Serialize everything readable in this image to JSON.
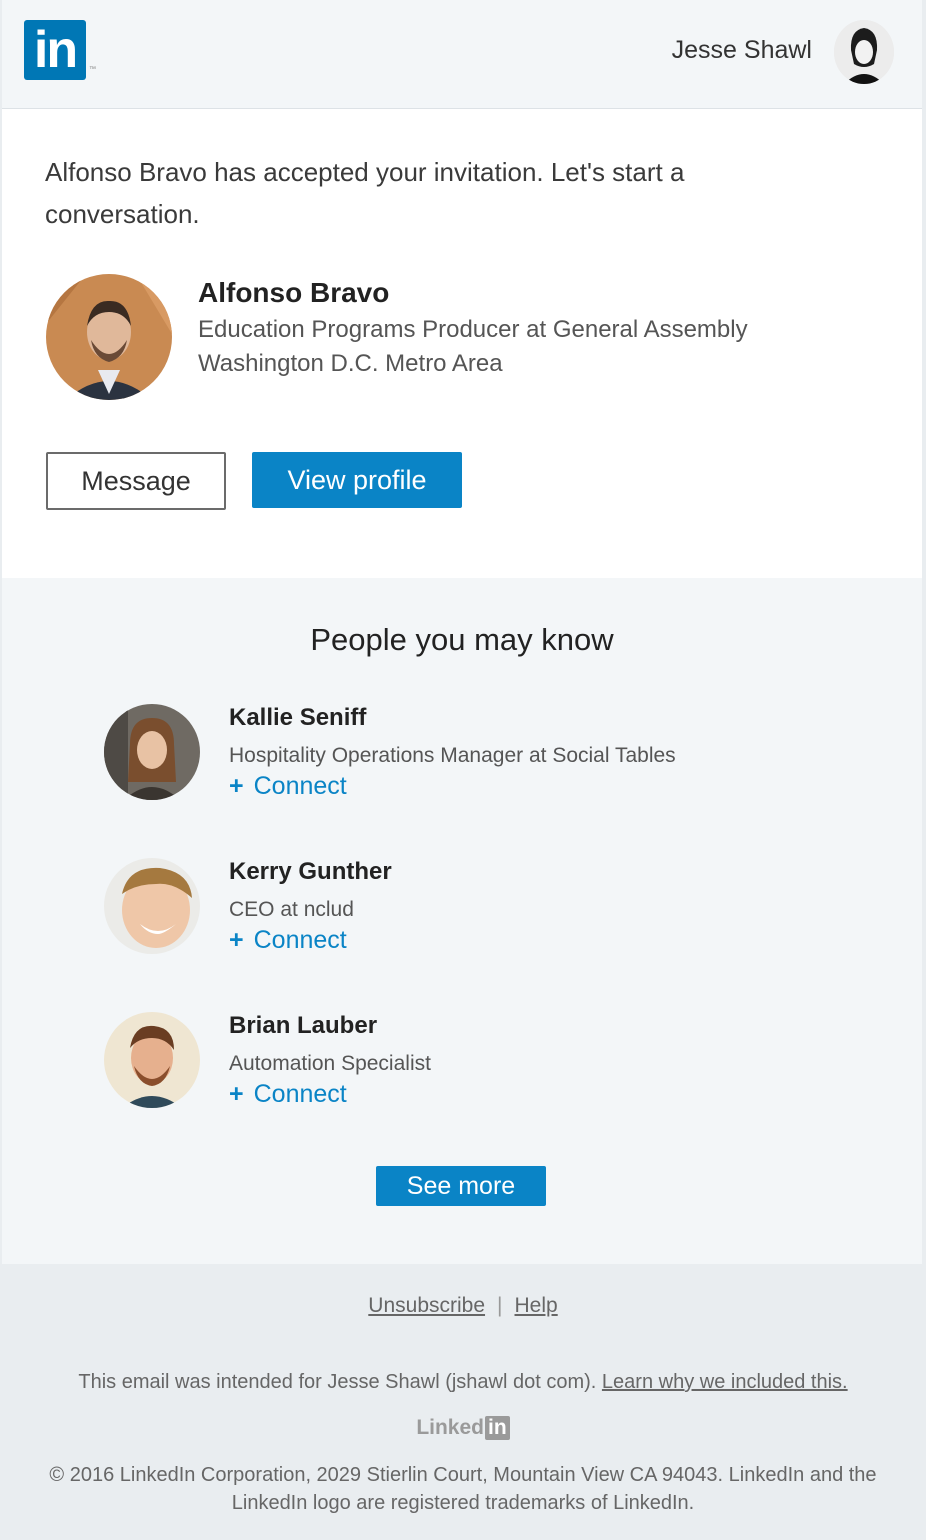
{
  "header": {
    "logo_text": "in",
    "logo_tm": "™",
    "user_name": "Jesse Shawl",
    "avatar_icon": "user-avatar-photo"
  },
  "main": {
    "intro": "Alfonso Bravo has accepted your invitation. Let's start a conversation.",
    "person": {
      "name": "Alfonso Bravo",
      "title": "Education Programs Producer at General Assembly",
      "location": "Washington D.C. Metro Area"
    },
    "buttons": {
      "message": "Message",
      "view_profile": "View profile"
    }
  },
  "pymk": {
    "title": "People you may know",
    "connect_icon": "+",
    "people": [
      {
        "name": "Kallie Seniff",
        "headline": "Hospitality Operations Manager at Social Tables",
        "connect": "Connect"
      },
      {
        "name": "Kerry Gunther",
        "headline": "CEO at nclud",
        "connect": "Connect"
      },
      {
        "name": "Brian Lauber",
        "headline": "Automation Specialist",
        "connect": "Connect"
      }
    ],
    "see_more": "See more"
  },
  "footer": {
    "unsubscribe": "Unsubscribe",
    "separator": "|",
    "help": "Help",
    "intended": "This email was intended for Jesse Shawl (jshawl dot com).",
    "learn_why": "Learn why we included this.",
    "logo_linked": "Linked",
    "logo_in": "in",
    "copyright": "© 2016 LinkedIn Corporation, 2029 Stierlin Court, Mountain View CA 94043. LinkedIn and the LinkedIn logo are registered trademarks of LinkedIn."
  },
  "colors": {
    "brand_blue": "#0077b5",
    "button_blue": "#0a84c6",
    "background": "#f3f6f8"
  }
}
